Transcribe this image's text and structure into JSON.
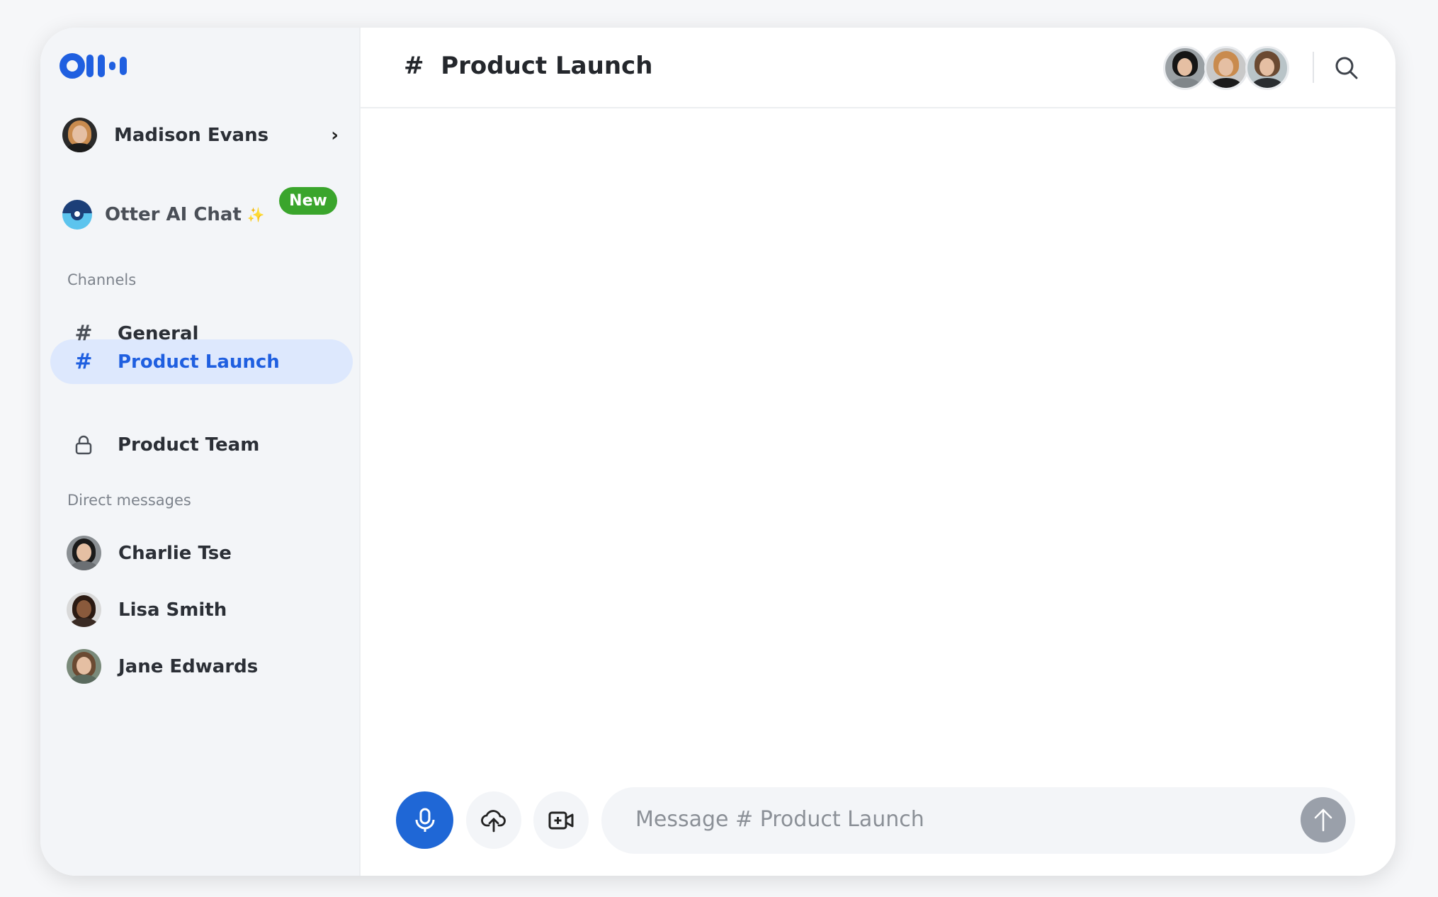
{
  "app": {
    "brand_color": "#1f5fe0"
  },
  "sidebar": {
    "user": {
      "name": "Madison Evans"
    },
    "otter_chat": {
      "label": "Otter AI Chat",
      "sparkle": "✨",
      "badge": "New",
      "badge_color": "#3aa52c"
    },
    "channels_label": "Channels",
    "channels": [
      {
        "icon": "hash-icon",
        "label": "General",
        "selected": false
      },
      {
        "icon": "hash-icon",
        "label": "Product Launch",
        "selected": true
      },
      {
        "icon": "lock-icon",
        "label": "Product Team",
        "selected": false
      }
    ],
    "dm_label": "Direct messages",
    "direct_messages": [
      {
        "name": "Charlie Tse"
      },
      {
        "name": "Lisa Smith"
      },
      {
        "name": "Jane Edwards"
      }
    ]
  },
  "header": {
    "hash": "#",
    "title": "Product Launch",
    "member_count_shown": 3
  },
  "composer": {
    "placeholder": "Message # Product Launch",
    "value": ""
  }
}
